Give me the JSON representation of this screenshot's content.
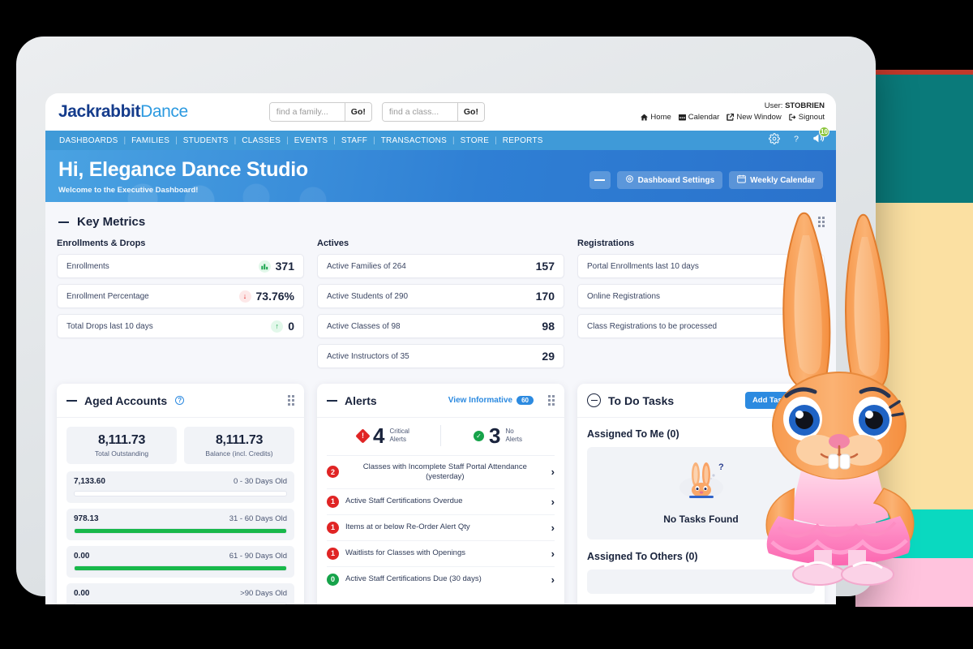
{
  "brand": {
    "name_bold": "Jackrabbit",
    "name_light": "Dance"
  },
  "search": {
    "family_placeholder": "find a family...",
    "family_value": "",
    "class_placeholder": "find a class...",
    "class_value": "",
    "go_label": "Go!"
  },
  "user": {
    "prefix": "User:",
    "name": "STOBRIEN",
    "links": [
      {
        "label": "Home",
        "icon": "home-icon"
      },
      {
        "label": "Calendar",
        "icon": "calendar-icon"
      },
      {
        "label": "New Window",
        "icon": "external-window-icon"
      },
      {
        "label": "Signout",
        "icon": "signout-icon"
      }
    ]
  },
  "nav": {
    "items": [
      "DASHBOARDS",
      "FAMILIES",
      "STUDENTS",
      "CLASSES",
      "EVENTS",
      "STAFF",
      "TRANSACTIONS",
      "STORE",
      "REPORTS"
    ],
    "icons": [
      {
        "name": "gear-icon"
      },
      {
        "name": "question-mark-icon"
      },
      {
        "name": "megaphone-icon",
        "badge": "10"
      }
    ],
    "notification_badge": "10",
    "badge_color": "#8dc63f"
  },
  "hero": {
    "title": "Hi, Elegance Dance Studio",
    "subtitle": "Welcome to the Executive Dashboard!",
    "collapse_label": "—",
    "settings_label": "Dashboard Settings",
    "calendar_label": "Weekly Calendar"
  },
  "key_metrics": {
    "title": "Key Metrics",
    "columns": [
      {
        "title": "Enrollments & Drops",
        "rows": [
          {
            "label": "Enrollments",
            "value": "371",
            "chip": "green",
            "chip_glyph": "█",
            "icon": "bar-chart-icon"
          },
          {
            "label": "Enrollment Percentage",
            "value": "73.76%",
            "chip": "red",
            "chip_glyph": "↓",
            "icon": "arrow-down-icon"
          },
          {
            "label": "Total Drops last 10 days",
            "value": "0",
            "chip": "green",
            "chip_glyph": "↑",
            "icon": "arrow-up-icon"
          }
        ]
      },
      {
        "title": "Actives",
        "rows": [
          {
            "label": "Active Families of 264",
            "value": "157",
            "chip": "",
            "chip_glyph": "",
            "icon": ""
          },
          {
            "label": "Active Students of 290",
            "value": "170",
            "chip": "",
            "chip_glyph": "",
            "icon": ""
          },
          {
            "label": "Active Classes of 98",
            "value": "98",
            "chip": "",
            "chip_glyph": "",
            "icon": ""
          },
          {
            "label": "Active Instructors of 35",
            "value": "29",
            "chip": "",
            "chip_glyph": "",
            "icon": ""
          }
        ]
      },
      {
        "title": "Registrations",
        "rows": [
          {
            "label": "Portal Enrollments last 10 days",
            "value": "",
            "chip": "",
            "chip_glyph": "",
            "icon": ""
          },
          {
            "label": "Online Registrations",
            "value": "",
            "chip": "",
            "chip_glyph": "",
            "icon": ""
          },
          {
            "label": "Class Registrations to be processed",
            "value": "",
            "chip": "",
            "chip_glyph": "",
            "icon": ""
          }
        ]
      }
    ]
  },
  "aged_accounts": {
    "title": "Aged Accounts",
    "tiles": [
      {
        "amount": "8,111.73",
        "caption": "Total Outstanding"
      },
      {
        "amount": "8,111.73",
        "caption": "Balance (incl. Credits)"
      }
    ],
    "buckets": [
      {
        "amount": "7,133.60",
        "label": "0 - 30 Days Old",
        "fill_pct": 0
      },
      {
        "amount": "978.13",
        "label": "31 - 60 Days Old",
        "fill_pct": 100
      },
      {
        "amount": "0.00",
        "label": "61 - 90 Days Old",
        "fill_pct": 100
      },
      {
        "amount": "0.00",
        "label": ">90 Days Old",
        "fill_pct": 0
      }
    ]
  },
  "alerts": {
    "title": "Alerts",
    "view_informative_label": "View Informative",
    "view_informative_count": "60",
    "critical": {
      "count": "4",
      "label_line1": "Critical",
      "label_line2": "Alerts"
    },
    "clear": {
      "count": "3",
      "label_line1": "No",
      "label_line2": "Alerts"
    },
    "rows": [
      {
        "count": "2",
        "tone": "red",
        "text": "Classes with Incomplete Staff Portal Attendance (yesterday)"
      },
      {
        "count": "1",
        "tone": "red",
        "text": "Active Staff Certifications Overdue"
      },
      {
        "count": "1",
        "tone": "red",
        "text": "Items at or below Re-Order Alert Qty"
      },
      {
        "count": "1",
        "tone": "red",
        "text": "Waitlists for Classes with Openings"
      },
      {
        "count": "0",
        "tone": "green",
        "text": "Active Staff Certifications Due (30 days)"
      }
    ]
  },
  "todo": {
    "title": "To Do Tasks",
    "add_label": "Add Task",
    "assigned_me": "Assigned To Me (0)",
    "empty_text": "No Tasks Found",
    "assigned_others": "Assigned To Others (0)"
  },
  "colors": {
    "brand_dark": "#153c8c",
    "brand_light": "#2c9ae0",
    "nav_blue": "#3f9ad8",
    "hero_blue": "#2f7fd4",
    "green": "#16a34a",
    "red": "#e02424",
    "bar_green": "#18b84a",
    "badge_green": "#8dc63f"
  }
}
